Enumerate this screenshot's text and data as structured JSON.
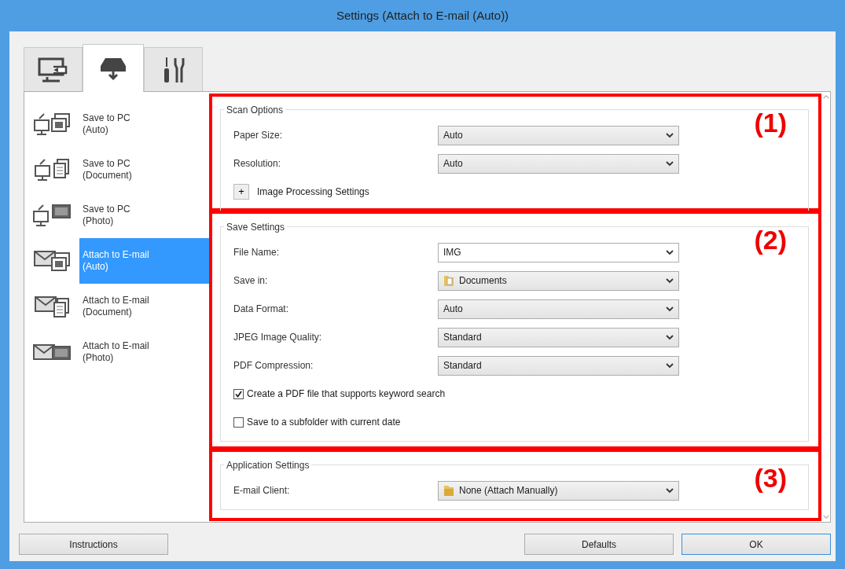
{
  "window": {
    "title": "Settings (Attach to E-mail (Auto))"
  },
  "tabs": [
    {
      "kind": "computer",
      "selected": false
    },
    {
      "kind": "scanner",
      "selected": true
    },
    {
      "kind": "tools",
      "selected": false
    }
  ],
  "sidebar": {
    "items": [
      {
        "title": "Save to PC",
        "subtitle": "(Auto)",
        "kind": "pc-auto",
        "selected": false
      },
      {
        "title": "Save to PC",
        "subtitle": "(Document)",
        "kind": "pc-document",
        "selected": false
      },
      {
        "title": "Save to PC",
        "subtitle": "(Photo)",
        "kind": "pc-photo",
        "selected": false
      },
      {
        "title": "Attach to E-mail",
        "subtitle": "(Auto)",
        "kind": "mail-auto",
        "selected": true
      },
      {
        "title": "Attach to E-mail",
        "subtitle": "(Document)",
        "kind": "mail-document",
        "selected": false
      },
      {
        "title": "Attach to E-mail",
        "subtitle": "(Photo)",
        "kind": "mail-photo",
        "selected": false
      }
    ]
  },
  "sections": [
    {
      "title": "Scan Options",
      "callout": "(1)",
      "fields": [
        {
          "kind": "select",
          "label": "Paper Size:",
          "value": "Auto"
        },
        {
          "kind": "select",
          "label": "Resolution:",
          "value": "Auto"
        },
        {
          "kind": "expander",
          "symbol": "+",
          "label": "Image Processing Settings"
        }
      ]
    },
    {
      "title": "Save Settings",
      "callout": "(2)",
      "fields": [
        {
          "kind": "select",
          "label": "File Name:",
          "value": "IMG",
          "editable": true
        },
        {
          "kind": "folder-select",
          "label": "Save in:",
          "value": "Documents"
        },
        {
          "kind": "select",
          "label": "Data Format:",
          "value": "Auto"
        },
        {
          "kind": "select",
          "label": "JPEG Image Quality:",
          "value": "Standard"
        },
        {
          "kind": "select",
          "label": "PDF Compression:",
          "value": "Standard"
        },
        {
          "kind": "checkbox",
          "label": "Create a PDF file that supports keyword search",
          "checked": true
        },
        {
          "kind": "checkbox",
          "label": "Save to a subfolder with current date",
          "checked": false
        }
      ]
    },
    {
      "title": "Application Settings",
      "callout": "(3)",
      "fields": [
        {
          "kind": "folder-select",
          "label": "E-mail Client:",
          "value": "None (Attach Manually)"
        }
      ]
    }
  ],
  "buttons": [
    {
      "label": "Instructions",
      "default": false
    },
    {
      "label": "Defaults",
      "default": false
    },
    {
      "label": "OK",
      "default": true
    }
  ]
}
